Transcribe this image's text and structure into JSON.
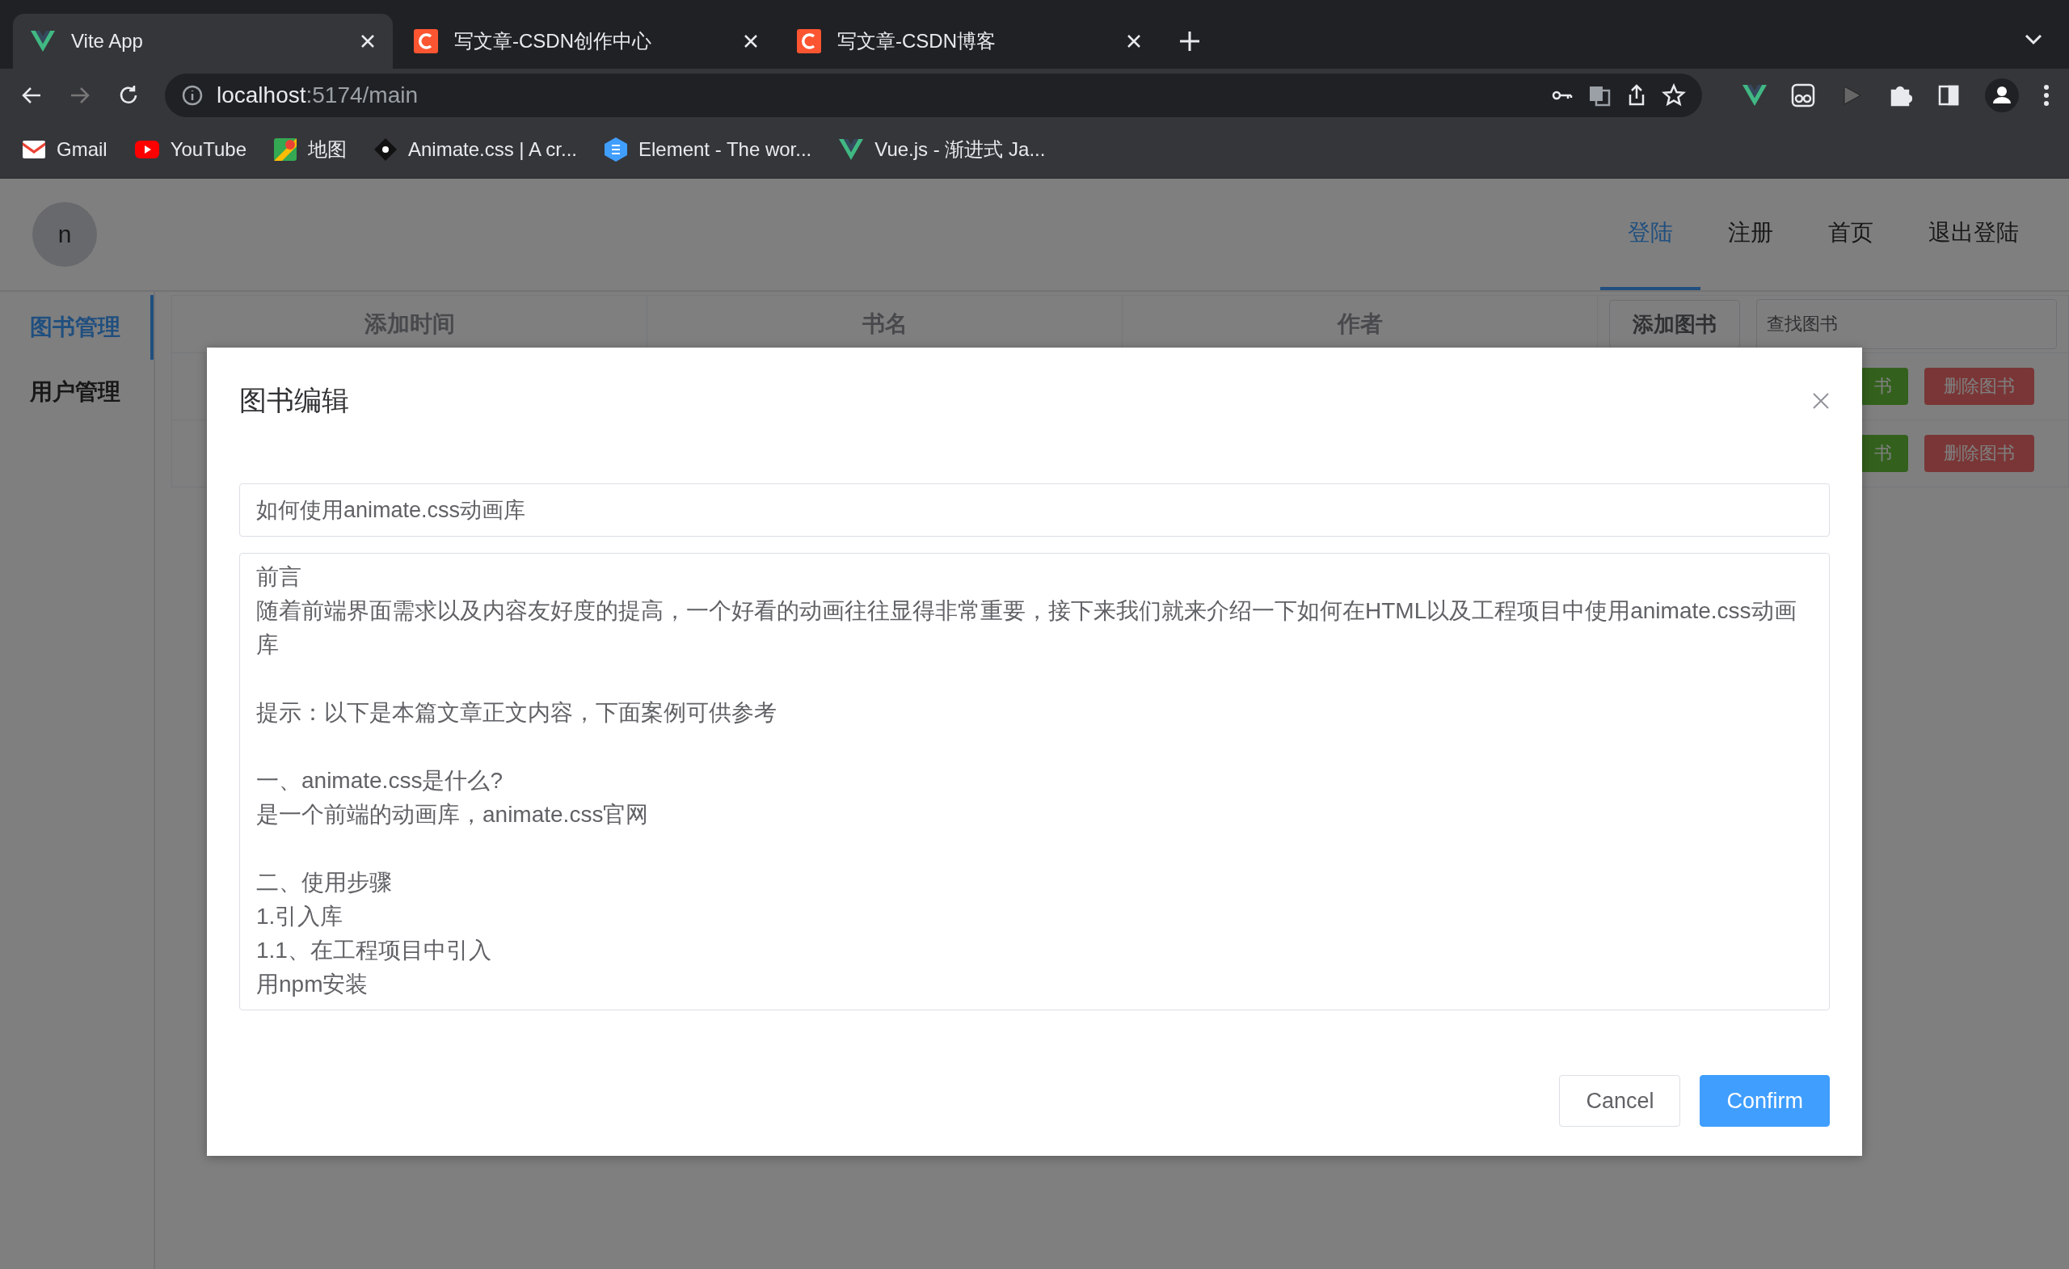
{
  "browser": {
    "tabs": [
      {
        "title": "Vite App",
        "kind": "vue",
        "selected": true
      },
      {
        "title": "写文章-CSDN创作中心",
        "kind": "csdn",
        "selected": false
      },
      {
        "title": "写文章-CSDN博客",
        "kind": "csdn",
        "selected": false
      }
    ],
    "address": {
      "host": "localhost",
      "path": ":5174/main"
    },
    "bookmarks": [
      {
        "label": "Gmail",
        "kind": "gmail"
      },
      {
        "label": "YouTube",
        "kind": "youtube"
      },
      {
        "label": "地图",
        "kind": "maps"
      },
      {
        "label": "Animate.css | A cr...",
        "kind": "animate"
      },
      {
        "label": "Element - The wor...",
        "kind": "element"
      },
      {
        "label": "Vue.js - 渐进式 Ja...",
        "kind": "vue"
      }
    ]
  },
  "header": {
    "avatar": "n",
    "nav": [
      {
        "label": "登陆",
        "selected": true
      },
      {
        "label": "注册",
        "selected": false
      },
      {
        "label": "首页",
        "selected": false
      },
      {
        "label": "退出登陆",
        "selected": false
      }
    ]
  },
  "sidebar": {
    "items": [
      {
        "label": "图书管理",
        "selected": true
      },
      {
        "label": "用户管理",
        "selected": false
      }
    ]
  },
  "table": {
    "columns": [
      "添加时间",
      "书名",
      "作者"
    ],
    "add_button": "添加图书",
    "search": {
      "placeholder": "查找图书"
    },
    "rows": [
      {
        "edit": "书",
        "delete": "删除图书"
      },
      {
        "edit": "书",
        "delete": "删除图书"
      }
    ]
  },
  "dialog": {
    "title": "图书编辑",
    "name": "如何使用animate.css动画库",
    "content": [
      [
        "前言",
        "随着前端界面需求以及内容友好度的提高，一个好看的动画往往显得非常重要，接下来我们就来介绍一下如何在HTML以及工程项目中使用animate.css动画库"
      ],
      [
        "提示：以下是本篇文章正文内容，下面案例可供参考"
      ],
      [
        "一、animate.css是什么?",
        "是一个前端的动画库，animate.css官网"
      ],
      [
        "二、使用步骤",
        "1.引入库",
        "1.1、在工程项目中引入",
        "用npm安装"
      ]
    ],
    "buttons": [
      {
        "label": "Cancel",
        "kind": "default"
      },
      {
        "label": "Confirm",
        "kind": "primary"
      }
    ]
  }
}
